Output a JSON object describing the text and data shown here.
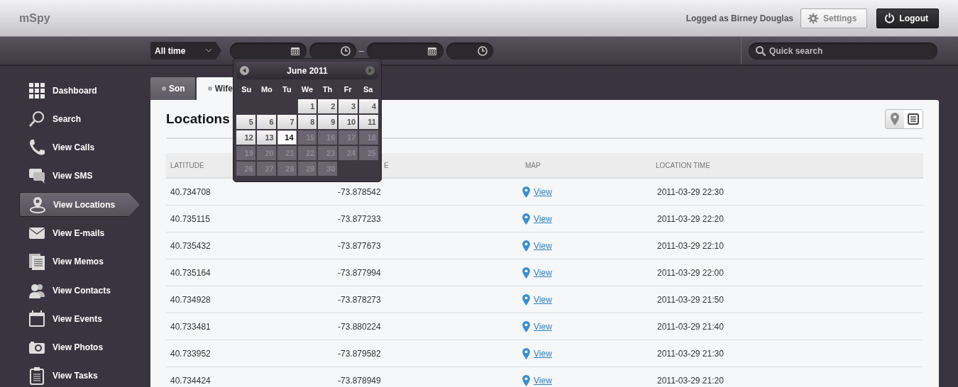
{
  "header": {
    "logo": "mSpy",
    "user": "Logged as Birney Douglas",
    "settings": "Settings",
    "logout": "Logout"
  },
  "toolbar": {
    "range": "All time",
    "separator": "–",
    "search_placeholder": "Quick search"
  },
  "calendar": {
    "title": "June 2011",
    "weekdays": [
      "Su",
      "Mo",
      "Tu",
      "We",
      "Th",
      "Fr",
      "Sa"
    ],
    "weeks": [
      [
        {
          "day": "1",
          "disabled": false,
          "selected": false
        },
        {
          "day": "2",
          "disabled": false,
          "selected": false
        },
        {
          "day": "3",
          "disabled": false,
          "selected": false
        },
        {
          "day": "4",
          "disabled": false,
          "selected": false
        }
      ],
      [
        {
          "day": "5",
          "disabled": false,
          "selected": false
        },
        {
          "day": "6",
          "disabled": false,
          "selected": false
        },
        {
          "day": "7",
          "disabled": false,
          "selected": false
        },
        {
          "day": "8",
          "disabled": false,
          "selected": false
        },
        {
          "day": "9",
          "disabled": false,
          "selected": false
        },
        {
          "day": "10",
          "disabled": false,
          "selected": false
        },
        {
          "day": "11",
          "disabled": false,
          "selected": false
        }
      ],
      [
        {
          "day": "12",
          "disabled": false,
          "selected": false
        },
        {
          "day": "13",
          "disabled": false,
          "selected": false
        },
        {
          "day": "14",
          "disabled": false,
          "selected": true
        },
        {
          "day": "15",
          "disabled": true,
          "selected": false
        },
        {
          "day": "16",
          "disabled": true,
          "selected": false
        },
        {
          "day": "17",
          "disabled": true,
          "selected": false
        },
        {
          "day": "18",
          "disabled": true,
          "selected": false
        }
      ],
      [
        {
          "day": "19",
          "disabled": true,
          "selected": false
        },
        {
          "day": "20",
          "disabled": true,
          "selected": false
        },
        {
          "day": "21",
          "disabled": true,
          "selected": false
        },
        {
          "day": "22",
          "disabled": true,
          "selected": false
        },
        {
          "day": "23",
          "disabled": true,
          "selected": false
        },
        {
          "day": "24",
          "disabled": true,
          "selected": false
        },
        {
          "day": "25",
          "disabled": true,
          "selected": false
        }
      ],
      [
        {
          "day": "26",
          "disabled": true,
          "selected": false
        },
        {
          "day": "27",
          "disabled": true,
          "selected": false
        },
        {
          "day": "28",
          "disabled": true,
          "selected": false
        },
        {
          "day": "29",
          "disabled": true,
          "selected": false
        },
        {
          "day": "30",
          "disabled": true,
          "selected": false
        }
      ]
    ]
  },
  "sidebar": {
    "items": [
      {
        "label": "Dashboard",
        "selected": false
      },
      {
        "label": "Search",
        "selected": false
      },
      {
        "label": "View Calls",
        "selected": false
      },
      {
        "label": "View SMS",
        "selected": false
      },
      {
        "label": "View Locations",
        "selected": true
      },
      {
        "label": "View E-mails",
        "selected": false
      },
      {
        "label": "View Memos",
        "selected": false
      },
      {
        "label": "View Contacts",
        "selected": false
      },
      {
        "label": "View Events",
        "selected": false
      },
      {
        "label": "View Photos",
        "selected": false
      },
      {
        "label": "View Tasks",
        "selected": false
      }
    ]
  },
  "tabs": [
    {
      "label": "Son",
      "selected": false
    },
    {
      "label": "Wife",
      "selected": true
    }
  ],
  "panel": {
    "title": "Locations",
    "view_modes": [
      {
        "kind": "map",
        "selected": false
      },
      {
        "kind": "list",
        "selected": true
      }
    ]
  },
  "table": {
    "columns": [
      "LATITUDE",
      "E",
      "MAP",
      "LOCATION TIME"
    ],
    "rows": [
      {
        "latitude": "40.734708",
        "longitude": "-73.878542",
        "map": "View",
        "time": "2011-03-29 22:30"
      },
      {
        "latitude": "40.735115",
        "longitude": "-73.877233",
        "map": "View",
        "time": "2011-03-29 22:20"
      },
      {
        "latitude": "40.735432",
        "longitude": "-73.877673",
        "map": "View",
        "time": "2011-03-29 22:10"
      },
      {
        "latitude": "40.735164",
        "longitude": "-73.877994",
        "map": "View",
        "time": "2011-03-29 22:00"
      },
      {
        "latitude": "40.734928",
        "longitude": "-73.878273",
        "map": "View",
        "time": "2011-03-29 21:50"
      },
      {
        "latitude": "40.733481",
        "longitude": "-73.880224",
        "map": "View",
        "time": "2011-03-29 21:40"
      },
      {
        "latitude": "40.733952",
        "longitude": "-73.879582",
        "map": "View",
        "time": "2011-03-29 21:30"
      },
      {
        "latitude": "40.734424",
        "longitude": "-73.878949",
        "map": "View",
        "time": "2011-03-29 21:20"
      }
    ]
  }
}
